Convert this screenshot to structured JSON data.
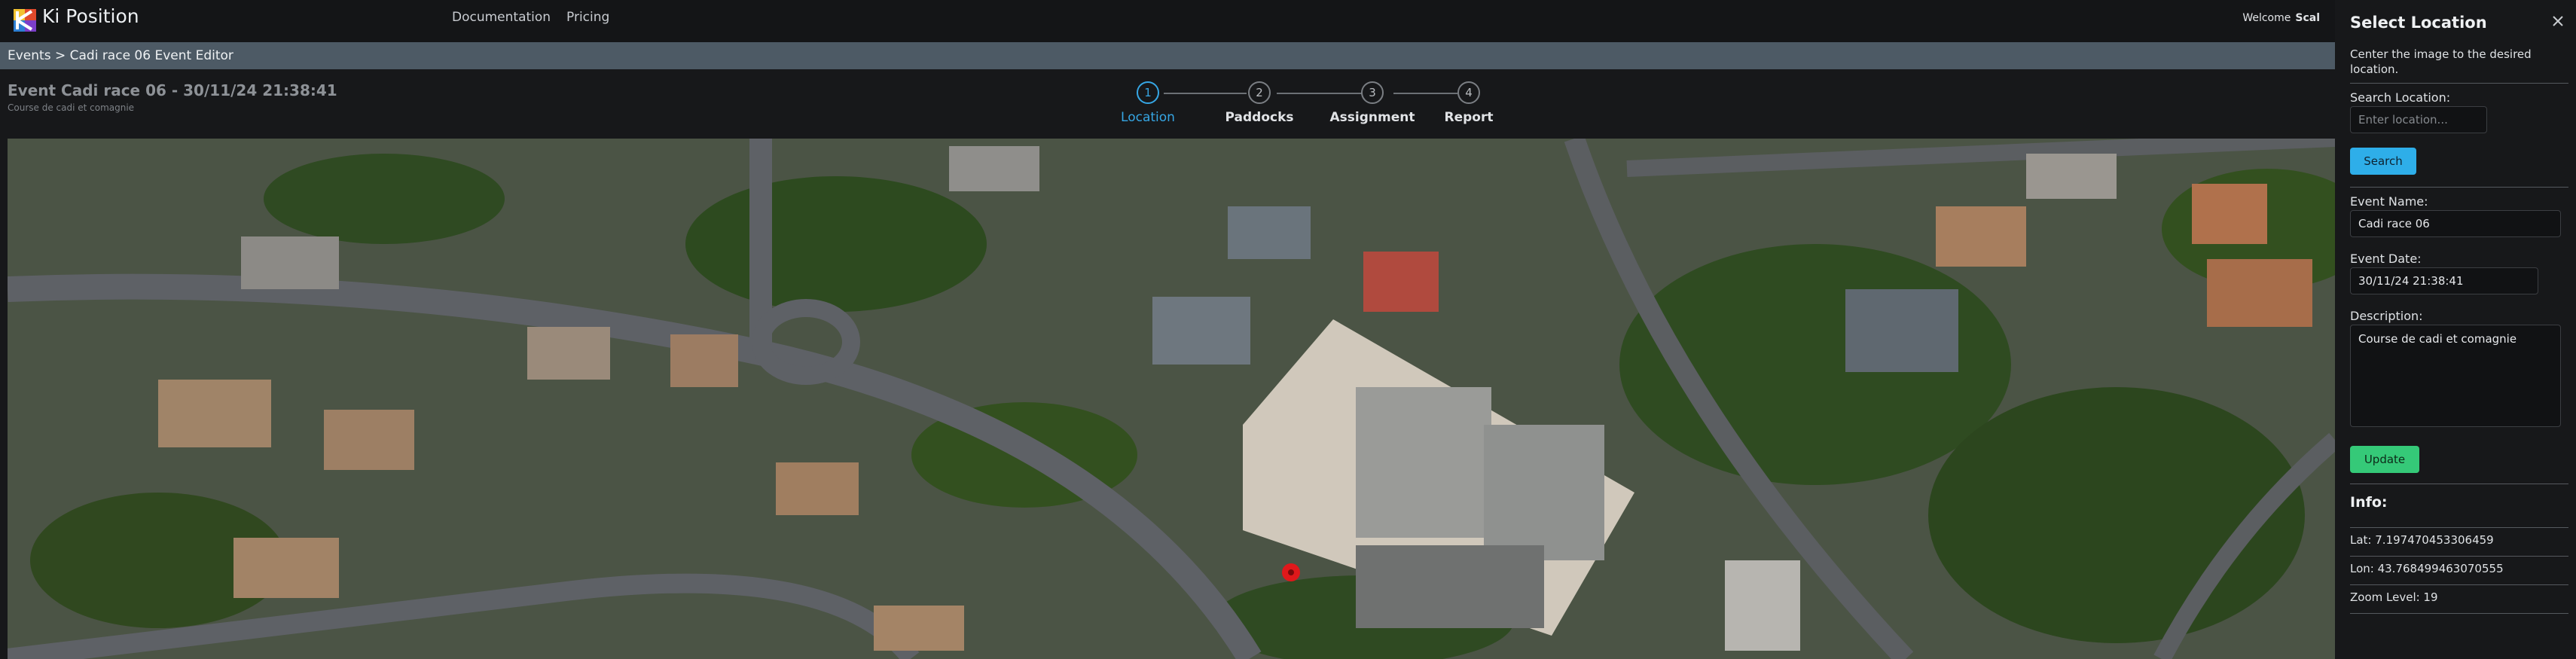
{
  "app": {
    "brand": "Ki Position"
  },
  "nav": {
    "documentation": "Documentation",
    "pricing": "Pricing",
    "welcome": "Welcome",
    "user": "Scal"
  },
  "breadcrumb": "Events > Cadi race 06 Event Editor",
  "event": {
    "title": "Event Cadi race 06 - 30/11/24 21:38:41",
    "subtitle": "Course de cadi et comagnie"
  },
  "stepper": {
    "active_step": 1,
    "steps": [
      {
        "number": "1",
        "label": "Location"
      },
      {
        "number": "2",
        "label": "Paddocks"
      },
      {
        "number": "3",
        "label": "Assignment"
      },
      {
        "number": "4",
        "label": "Report"
      }
    ]
  },
  "panel": {
    "title": "Select Location",
    "instructions": "Center the image to the desired location.",
    "search_label": "Search Location:",
    "search_placeholder": "Enter location...",
    "search_button": "Search",
    "event_name_label": "Event Name:",
    "event_name_value": "Cadi race 06",
    "event_date_label": "Event Date:",
    "event_date_value": "30/11/24 21:38:41",
    "description_label": "Description:",
    "description_value": "Course de cadi et comagnie",
    "update_button": "Update",
    "info_title": "Info:",
    "lat": "Lat: 7.197470453306459",
    "lon": "Lon: 43.768499463070555",
    "zoom": "Zoom Level: 19"
  },
  "icons": {
    "logo": "ki-position-logo",
    "close": "close-icon",
    "marker": "map-marker-icon"
  },
  "colors": {
    "accent": "#36a6e4",
    "search": "#2eaee9",
    "update": "#35c978",
    "marker": "#e0181b"
  }
}
